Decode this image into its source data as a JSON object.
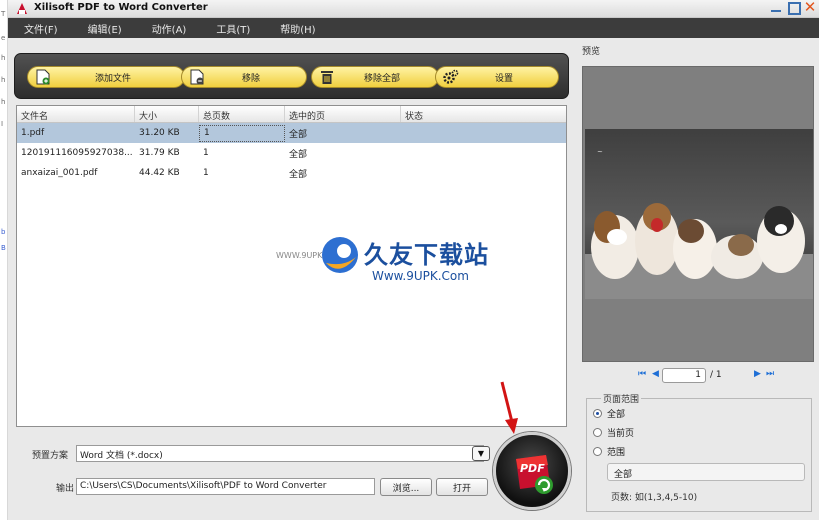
{
  "window": {
    "title": "Xilisoft PDF to Word Converter"
  },
  "desktop_strip": [
    "T",
    "e",
    "h",
    "h",
    "h",
    "I",
    "b",
    "B"
  ],
  "menu": [
    "文件(F)",
    "编辑(E)",
    "动作(A)",
    "工具(T)",
    "帮助(H)"
  ],
  "toolbar": {
    "add_label": "添加文件",
    "remove_label": "移除",
    "remove_all_label": "移除全部",
    "settings_label": "设置"
  },
  "file_table": {
    "columns": [
      "文件名",
      "大小",
      "总页数",
      "选中的页",
      "状态"
    ],
    "rows": [
      {
        "name": "1.pdf",
        "size": "31.20 KB",
        "pages": "1",
        "selected_pages": "全部",
        "status": ""
      },
      {
        "name": "120191116095927038...",
        "size": "31.79 KB",
        "pages": "1",
        "selected_pages": "全部",
        "status": ""
      },
      {
        "name": "anxaizai_001.pdf",
        "size": "44.42 KB",
        "pages": "1",
        "selected_pages": "全部",
        "status": ""
      }
    ],
    "selected_row": 0
  },
  "watermark": {
    "cn": "久友下载站",
    "url": "Www.9UPK.Com",
    "small": "WWW.9UPK.COM"
  },
  "output": {
    "preset_label": "预置方案",
    "preset_value": "Word 文档 (*.docx)",
    "output_label": "输出",
    "output_path": "C:\\Users\\CS\\Documents\\Xilisoft\\PDF to Word Converter",
    "browse_label": "浏览...",
    "open_label": "打开"
  },
  "convert_button": {
    "label": "PDF"
  },
  "preview": {
    "title": "预览",
    "current_page": "1",
    "total_pages": "/ 1"
  },
  "page_range": {
    "legend": "页面范围",
    "options": [
      "全部",
      "当前页",
      "范围"
    ],
    "selected": "全部",
    "range_value": "全部",
    "hint": "页数: 如(1,3,4,5-10)"
  },
  "colors": {
    "toolbar_button": "#f0cf3e",
    "menubar": "#3c3c3c",
    "selection": "#b3c7dc",
    "nav_blue": "#1e6fd6"
  }
}
